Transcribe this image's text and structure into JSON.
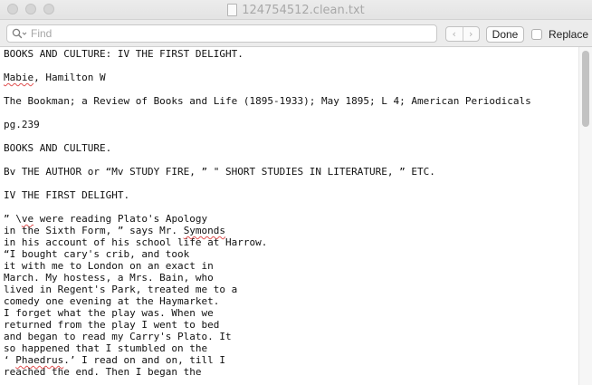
{
  "window": {
    "title": "124754512.clean.txt",
    "doc_icon": "document-icon"
  },
  "findbar": {
    "search_placeholder": "Find",
    "search_value": "",
    "prev_label": "‹",
    "next_label": "›",
    "done_label": "Done",
    "replace_label": "Replace",
    "replace_checked": false
  },
  "document": {
    "lines": {
      "l1": "BOOKS AND CULTURE: IV THE FIRST DELIGHT.",
      "l2a": "Mabie",
      "l2b": ", Hamilton W",
      "l3": "The Bookman; a Review of Books and Life (1895-1933); May 1895; L 4; American Periodicals",
      "l4": "pg.239",
      "l5": "BOOKS AND CULTURE.",
      "l6": "Bv THE AUTHOR or “Mv STUDY FIRE, ” \" SHORT STUDIES IN LITERATURE, ” ETC.",
      "l7": "IV THE FIRST DELIGHT.",
      "l8a": "” \\",
      "l8b": "ve",
      "l8c": " were reading Plato's Apology",
      "l9a": "in the Sixth Form, ” says Mr. ",
      "l9b": "Symonds",
      "l10": "in his account of his school life at Harrow.",
      "l11": "“I bought cary's crib, and took",
      "l12": "it with me to London on an exact in",
      "l13": "March. My hostess, a Mrs. Bain, who",
      "l14": "lived in Regent's Park, treated me to a",
      "l15": "comedy one evening at the Haymarket.",
      "l16": "I forget what the play was. When we",
      "l17": "returned from the play I went to bed",
      "l18": "and began to read my Carry's Plato. It",
      "l19": "so happened that I stumbled on the",
      "l20a": "‘ ",
      "l20b": "Phaedrus",
      "l20c": ".’ I read on and on, till I",
      "l21": "reached the end. Then I began the"
    }
  }
}
